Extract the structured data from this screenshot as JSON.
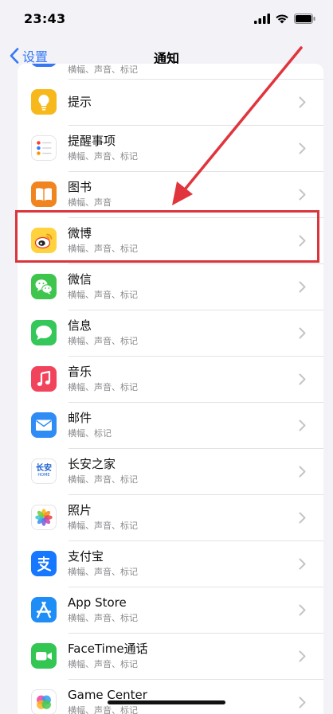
{
  "status_bar": {
    "time": "23:43"
  },
  "nav": {
    "back_label": "设置",
    "title": "通知"
  },
  "partial_row": {
    "subtitle": "横幅、声音、标记"
  },
  "apps": [
    {
      "name": "提示",
      "subtitle": "",
      "icon": "tips-icon"
    },
    {
      "name": "提醒事项",
      "subtitle": "横幅、声音、标记",
      "icon": "reminders-icon"
    },
    {
      "name": "图书",
      "subtitle": "横幅、声音",
      "icon": "books-icon"
    },
    {
      "name": "微博",
      "subtitle": "横幅、声音、标记",
      "icon": "weibo-icon"
    },
    {
      "name": "微信",
      "subtitle": "横幅、声音、标记",
      "icon": "wechat-icon"
    },
    {
      "name": "信息",
      "subtitle": "横幅、声音、标记",
      "icon": "messages-icon"
    },
    {
      "name": "音乐",
      "subtitle": "横幅、声音、标记",
      "icon": "music-icon"
    },
    {
      "name": "邮件",
      "subtitle": "横幅、标记",
      "icon": "mail-icon"
    },
    {
      "name": "长安之家",
      "subtitle": "横幅、声音、标记",
      "icon": "changan-icon"
    },
    {
      "name": "照片",
      "subtitle": "横幅、声音、标记",
      "icon": "photos-icon"
    },
    {
      "name": "支付宝",
      "subtitle": "横幅、声音、标记",
      "icon": "alipay-icon"
    },
    {
      "name": "App Store",
      "subtitle": "横幅、声音、标记",
      "icon": "app-store-icon"
    },
    {
      "name": "FaceTime通话",
      "subtitle": "横幅、声音、标记",
      "icon": "facetime-icon"
    },
    {
      "name": "Game Center",
      "subtitle": "横幅、声音、标记",
      "icon": "game-center-icon"
    }
  ],
  "icon_text": {
    "changan": "长安",
    "changan_small": "HOME"
  },
  "colors": {
    "accent": "#3478f6",
    "highlight": "#d9353b",
    "arrow": "#e0353c"
  }
}
